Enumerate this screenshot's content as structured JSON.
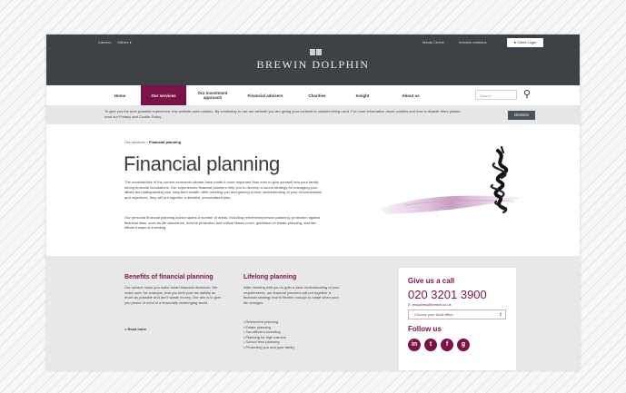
{
  "header": {
    "top_links_left": [
      "Careers",
      "Offices ▾"
    ],
    "top_links_right": [
      "Media Centre",
      "Investor relations"
    ],
    "login_label": "Client Login",
    "logo_text": "BREWIN DOLPHIN"
  },
  "nav": {
    "items": [
      {
        "label": "Home"
      },
      {
        "label": "Our services"
      },
      {
        "label": "Our investment approach"
      },
      {
        "label": "Financial advisers"
      },
      {
        "label": "Charities"
      },
      {
        "label": "Insight"
      },
      {
        "label": "About us"
      }
    ],
    "search_placeholder": "Search"
  },
  "cookie": {
    "text": "To give you the best possible experience, this website uses cookies. By continuing to use our website you are giving your consent to cookies being used. For more information about cookies and how to disable them please read our Privacy and Cookie Policy.",
    "dismiss_label": "Dismiss"
  },
  "main": {
    "breadcrumb_parent": "Our services",
    "breadcrumb_sep": ">",
    "breadcrumb_current": "Financial planning",
    "title": "Financial planning",
    "para1": "The uncertainties of the current economic climate have made it more important than ever to give yourself and your family strong financial foundations. Our experienced financial planners help you to develop a sound strategy for managing your affairs and safeguarding your long-term wealth. After meeting you and gaining a clear understanding of your circumstances and objectives, they will put together a detailed, personalised plan.",
    "para2": "Our personal financial planning advice spans a number of areas, including retirement/pension planning, protection against financial risks, such as life assurance, income protection and critical illness cover, guidance on estate planning, and tax-efficient ways of investing."
  },
  "lower": {
    "benefits_title": "Benefits of financial planning",
    "benefits_text": "Our service helps you make smart financial decisions. We make sure, for example, that you limit your tax liability as much as possible and don't waste money. Our aim is to give you peace of mind in a financially challenging world.",
    "read_more": "> Read more",
    "lifelong_title": "Lifelong planning",
    "lifelong_text": "After meeting with you to gain a clear understanding of your requirements, our financial planners will put together a financial strategy that is flexible enough to adapt when your life changes.",
    "lifelong_items": [
      "Retirement planning",
      "Estate planning",
      "Tax-efficient investing",
      "Planning for high earners",
      "School fees planning",
      "Protecting you and your family"
    ]
  },
  "contact": {
    "title": "Give us a call",
    "phone": "020 3201 3900",
    "email": "E: enquiries@brewin.co.uk",
    "office_select": "Choose your local office",
    "follow_title": "Follow us",
    "social_icons": [
      "linkedin-icon",
      "twitter-icon",
      "facebook-icon",
      "googleplus-icon"
    ]
  },
  "colors": {
    "brand": "#7a1448",
    "header_bg": "#3d4247"
  }
}
